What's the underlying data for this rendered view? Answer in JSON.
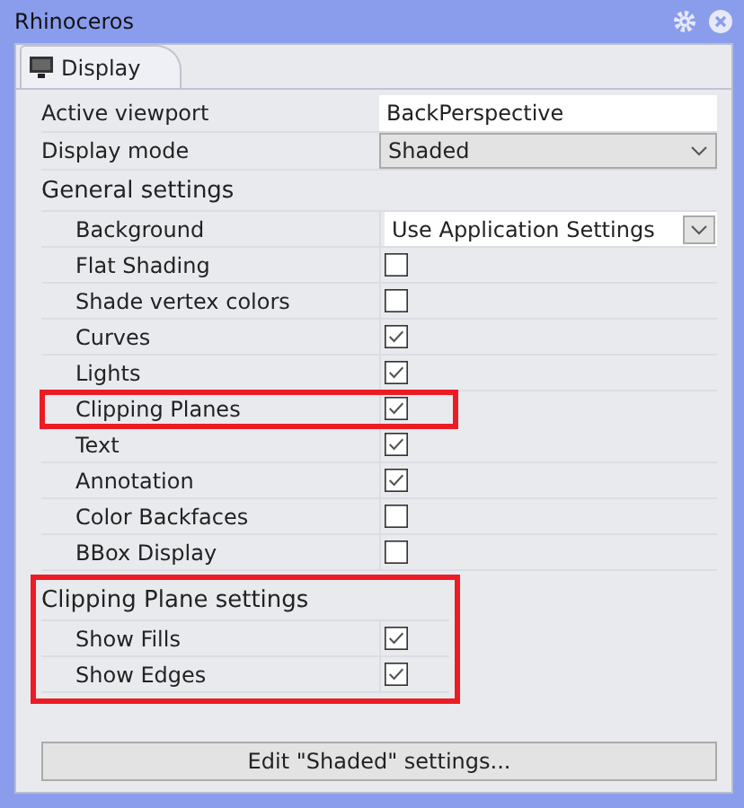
{
  "window": {
    "title": "Rhinoceros"
  },
  "tabs": [
    {
      "label": "Display",
      "selected": true
    }
  ],
  "top_rows": [
    {
      "label": "Active viewport",
      "kind": "text",
      "value": "BackPerspective"
    },
    {
      "label": "Display mode",
      "kind": "dropdown",
      "value": "Shaded"
    }
  ],
  "sections": [
    {
      "title": "General settings",
      "highlight": false,
      "rows": [
        {
          "label": "Background",
          "kind": "dropdown",
          "value": "Use Application Settings",
          "highlight": false
        },
        {
          "label": "Flat Shading",
          "kind": "checkbox",
          "checked": false,
          "highlight": false
        },
        {
          "label": "Shade vertex colors",
          "kind": "checkbox",
          "checked": false,
          "highlight": false
        },
        {
          "label": "Curves",
          "kind": "checkbox",
          "checked": true,
          "highlight": false
        },
        {
          "label": "Lights",
          "kind": "checkbox",
          "checked": true,
          "highlight": false
        },
        {
          "label": "Clipping Planes",
          "kind": "checkbox",
          "checked": true,
          "highlight": true
        },
        {
          "label": "Text",
          "kind": "checkbox",
          "checked": true,
          "highlight": false
        },
        {
          "label": "Annotation",
          "kind": "checkbox",
          "checked": true,
          "highlight": false
        },
        {
          "label": "Color Backfaces",
          "kind": "checkbox",
          "checked": false,
          "highlight": false
        },
        {
          "label": "BBox Display",
          "kind": "checkbox",
          "checked": false,
          "highlight": false
        }
      ]
    },
    {
      "title": "Clipping Plane settings",
      "highlight": true,
      "rows": [
        {
          "label": "Show Fills",
          "kind": "checkbox",
          "checked": true,
          "highlight": false
        },
        {
          "label": "Show Edges",
          "kind": "checkbox",
          "checked": true,
          "highlight": false
        }
      ]
    }
  ],
  "button": "Edit \"Shaded\" settings..."
}
